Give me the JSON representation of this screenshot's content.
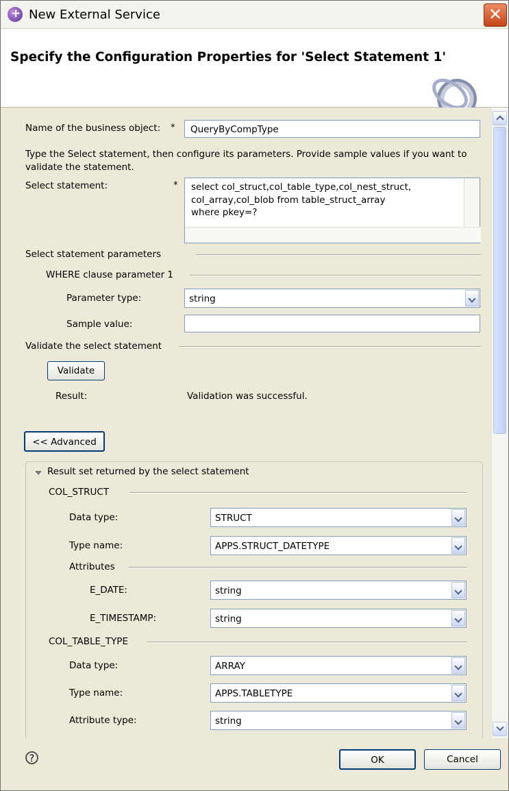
{
  "window": {
    "title": "New External Service",
    "close_label": "✕"
  },
  "header": {
    "title": "Specify the Configuration Properties for 'Select Statement 1'"
  },
  "form": {
    "bo_name_label": "Name of the business object:",
    "bo_name_value": "QueryByCompType",
    "required_mark": "*",
    "instructions": "Type the Select statement, then configure its parameters. Provide sample values if you want to validate the statement.",
    "select_label": "Select statement:",
    "select_value": "select col_struct,col_table_type,col_nest_struct,\ncol_array,col_blob from table_struct_array\nwhere pkey=?"
  },
  "parameters": {
    "section_label": "Select statement parameters",
    "where_label": "WHERE clause parameter 1",
    "param_type_label": "Parameter type:",
    "param_type_value": "string",
    "sample_value_label": "Sample value:",
    "sample_value": ""
  },
  "validate": {
    "section_label": "Validate the select statement",
    "button_label": "Validate",
    "result_label": "Result:",
    "result_value": "Validation was successful."
  },
  "advanced_button_label": "<< Advanced",
  "result_set": {
    "title": "Result set returned by the select statement",
    "col_struct": {
      "label": "COL_STRUCT",
      "data_type_label": "Data type:",
      "data_type_value": "STRUCT",
      "type_name_label": "Type name:",
      "type_name_value": "APPS.STRUCT_DATETYPE",
      "attributes_label": "Attributes",
      "e_date_label": "E_DATE:",
      "e_date_value": "string",
      "e_timestamp_label": "E_TIMESTAMP:",
      "e_timestamp_value": "string"
    },
    "col_table_type": {
      "label": "COL_TABLE_TYPE",
      "data_type_label": "Data type:",
      "data_type_value": "ARRAY",
      "type_name_label": "Type name:",
      "type_name_value": "APPS.TABLETYPE",
      "attribute_type_label": "Attribute type:",
      "attribute_type_value": "string"
    }
  },
  "footer": {
    "help_symbol": "?",
    "ok_label": "OK",
    "cancel_label": "Cancel"
  }
}
